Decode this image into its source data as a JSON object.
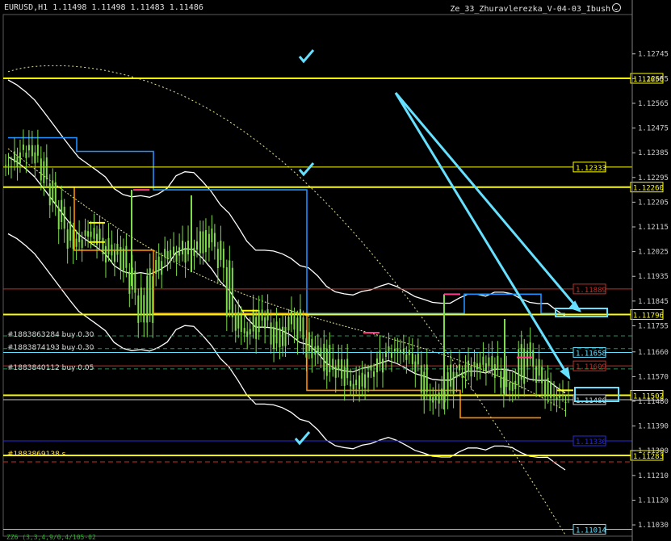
{
  "header": {
    "symbol": "EURUSD,H1",
    "ohlc": "1.11498 1.11498 1.11483 1.11486",
    "expert": "Ze_33_Zhuravlerezka_V-04-03_Ibush"
  },
  "order_labels": [
    {
      "text": "#1883863284 buy 0.30",
      "price": 1.11718
    },
    {
      "text": "#1883874193 buy 0.30",
      "price": 1.11672
    },
    {
      "text": "#1883840112 buy 0.05",
      "price": 1.11598
    },
    {
      "text": "#1883869138 s",
      "price": 1.11283
    }
  ],
  "footer_text": "ZZ6 (3,3,4,9/0,4/105-02",
  "colors": {
    "background": "#000000",
    "candle": "#7fdc4a",
    "yellow_level": "#ffff00",
    "blue_level": "#1e90ff",
    "cyan": "#66e0ff",
    "red_line": "#c03028",
    "navy": "#1010c8",
    "bollinger": "#ffffff",
    "ma_dotted": "#e6e69a",
    "orange_step": "#ff8c00"
  },
  "chart_data": {
    "type": "line",
    "symbol": "EURUSD",
    "timeframe": "H1",
    "ylim": [
      1.1096,
      1.1286
    ],
    "y_ticks": [
      1.12745,
      1.12655,
      1.12565,
      1.12475,
      1.12385,
      1.12295,
      1.12205,
      1.12115,
      1.12025,
      1.11935,
      1.11845,
      1.11755,
      1.1166,
      1.1157,
      1.1148,
      1.1139,
      1.113,
      1.1121,
      1.1112,
      1.1103
    ],
    "close_series": [
      1.1234,
      1.1238,
      1.124,
      1.1236,
      1.1228,
      1.122,
      1.1212,
      1.1205,
      1.1208,
      1.121,
      1.1206,
      1.12,
      1.1204,
      1.1196,
      1.1188,
      1.1178,
      1.1195,
      1.12,
      1.1203,
      1.12,
      1.1205,
      1.1202,
      1.121,
      1.1205,
      1.1198,
      1.118,
      1.1174,
      1.1172,
      1.118,
      1.1176,
      1.1168,
      1.1175,
      1.118,
      1.1172,
      1.1165,
      1.1168,
      1.1158,
      1.1162,
      1.1155,
      1.1153,
      1.1158,
      1.116,
      1.1165,
      1.1167,
      1.1166,
      1.1164,
      1.116,
      1.115,
      1.1148,
      1.1152,
      1.116,
      1.1158,
      1.1162,
      1.116,
      1.1163,
      1.1158,
      1.1152,
      1.1155,
      1.1168,
      1.1162,
      1.1156,
      1.115,
      1.1149,
      1.1149
    ],
    "horizontal_levels": [
      {
        "price": 1.12656,
        "label": "1.12656",
        "color": "#ffff00",
        "width": 2
      },
      {
        "price": 1.12333,
        "label": "1.12333",
        "color": "#ffff00",
        "width": 1
      },
      {
        "price": 1.1226,
        "label": "1.12260",
        "color": "#ffff00",
        "width": 2
      },
      {
        "price": 1.11889,
        "label": "1.11889",
        "color": "#c03028",
        "width": 1
      },
      {
        "price": 1.11796,
        "label": "1.11796",
        "color": "#ffff00",
        "width": 2
      },
      {
        "price": 1.11658,
        "label": "1.11658",
        "color": "#66e0ff",
        "width": 1
      },
      {
        "price": 1.11609,
        "label": "1.11609",
        "color": "#c03028",
        "width": 1
      },
      {
        "price": 1.11502,
        "label": "1.11502",
        "color": "#ffff00",
        "width": 2
      },
      {
        "price": 1.11486,
        "label": "1.11486",
        "color": "#cccccc",
        "width": 1
      },
      {
        "price": 1.11336,
        "label": "1.11336",
        "color": "#2a2ad8",
        "width": 1
      },
      {
        "price": 1.11283,
        "label": "1.11283",
        "color": "#ffff00",
        "width": 2
      },
      {
        "price": 1.11014,
        "label": "1.11014",
        "color": "#66e0ff",
        "width": 1
      }
    ],
    "annotations": [
      "checkmark",
      "checkmark",
      "checkmark",
      "arrow-down-right",
      "arrow-down-right"
    ]
  }
}
